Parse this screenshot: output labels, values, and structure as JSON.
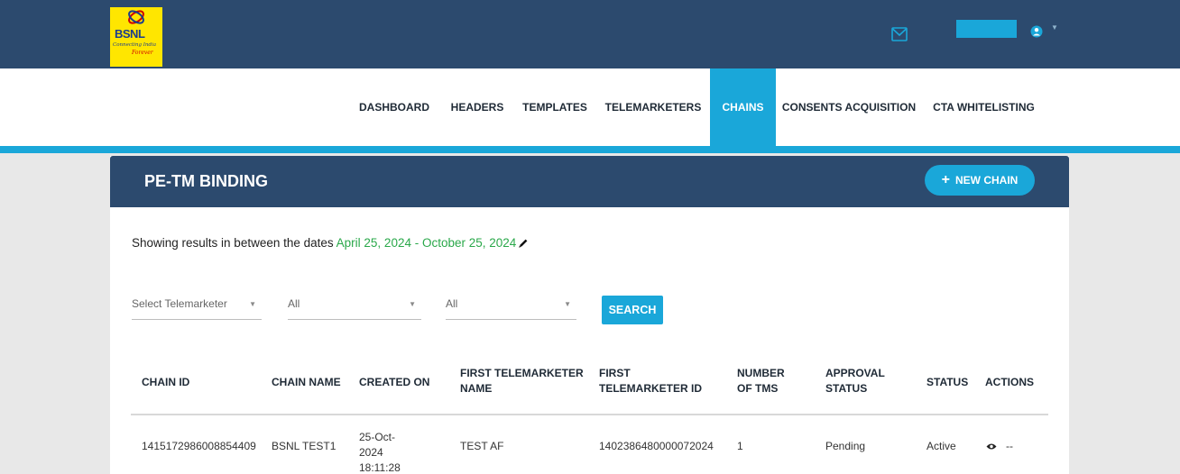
{
  "brand": {
    "name": "BSNL",
    "tagline": "Connecting India",
    "tagline_accent": "Forever"
  },
  "nav": {
    "items": [
      {
        "label": "DASHBOARD"
      },
      {
        "label": "HEADERS"
      },
      {
        "label": "TEMPLATES"
      },
      {
        "label": "TELEMARKETERS"
      },
      {
        "label": "CHAINS",
        "active": true
      },
      {
        "label": "CONSENTS ACQUISITION"
      },
      {
        "label": "CTA WHITELISTING"
      }
    ]
  },
  "page": {
    "title": "PE-TM BINDING",
    "new_button_label": "NEW CHAIN",
    "date_prefix": "Showing results in between the dates",
    "date_range": "April 25, 2024 - October 25, 2024"
  },
  "filters": {
    "telemarketer": "Select Telemarketer",
    "filter_2": "All",
    "filter_3": "All",
    "search_label": "SEARCH"
  },
  "table": {
    "columns": [
      "CHAIN ID",
      "CHAIN NAME",
      "CREATED ON",
      "FIRST TELEMARKETER NAME",
      "FIRST TELEMARKETER ID",
      "NUMBER OF TMS",
      "APPROVAL STATUS",
      "STATUS",
      "ACTIONS"
    ],
    "rows": [
      {
        "chain_id": "1415172986008854409",
        "chain_name": "BSNL TEST1",
        "created_on": "25-Oct-2024 18:11:28",
        "first_tm_name": "TEST AF",
        "first_tm_id": "1402386480000072024",
        "number_of_tms": "1",
        "approval_status": "Pending",
        "status": "Active",
        "actions_extra": "--"
      }
    ]
  },
  "colors": {
    "header_bg": "#2c4a6e",
    "accent": "#1aa7d9",
    "date_range": "#2aa84a",
    "page_bg": "#e8e8e8"
  },
  "icons": {
    "mail": "mail-icon",
    "user": "user-icon",
    "edit": "pencil-icon",
    "view": "eye-icon"
  }
}
